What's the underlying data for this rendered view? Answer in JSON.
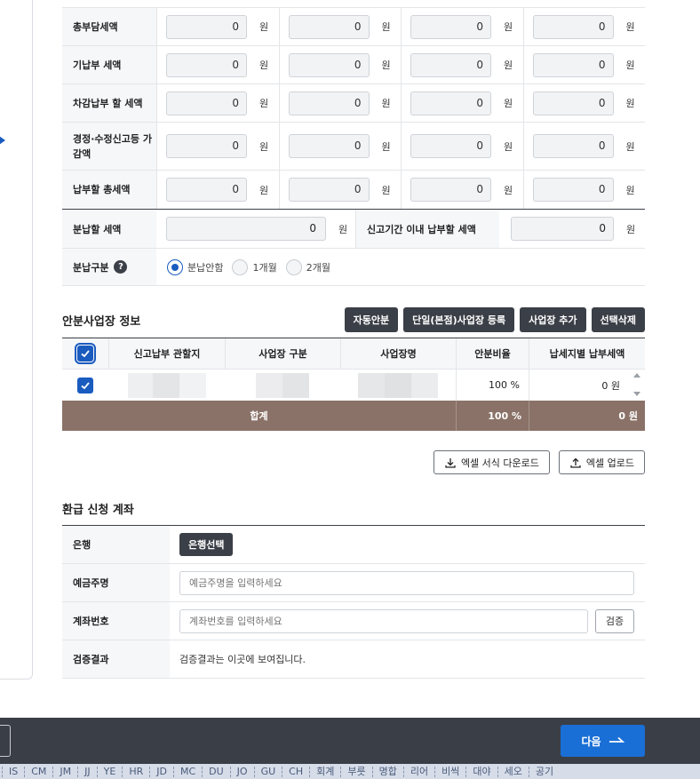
{
  "tax_grid": {
    "unit": "원",
    "rows": [
      {
        "label": "총부담세액",
        "values": [
          "0",
          "0",
          "0",
          "0"
        ]
      },
      {
        "label": "기납부 세액",
        "values": [
          "0",
          "0",
          "0",
          "0"
        ]
      },
      {
        "label": "차감납부 할 세액",
        "values": [
          "0",
          "0",
          "0",
          "0"
        ]
      },
      {
        "label": "경정·수정신고등 가감액",
        "values": [
          "0",
          "0",
          "0",
          "0"
        ]
      },
      {
        "label": "납부할 총세액",
        "values": [
          "0",
          "0",
          "0",
          "0"
        ]
      }
    ]
  },
  "split": {
    "label": "분납할 세액",
    "value": "0",
    "unit": "원",
    "deadline_label": "신고기간 이내 납부할 세액",
    "deadline_value": "0",
    "deadline_unit": "원"
  },
  "split_type": {
    "label": "분납구분",
    "help": "?",
    "options": [
      "분납안함",
      "1개월",
      "2개월"
    ],
    "selected": "분납안함"
  },
  "biz_section": {
    "title": "안분사업장 정보",
    "buttons": [
      "자동안분",
      "단일(본점)사업장 등록",
      "사업장 추가",
      "선택삭제"
    ],
    "columns": [
      "신고납부 관할지",
      "사업장 구분",
      "사업장명",
      "안분비율",
      "납세지별 납부세액"
    ],
    "rows": [
      {
        "ratio": "100 %",
        "amount": "0 원",
        "checked": true
      }
    ],
    "sum": {
      "label": "합계",
      "ratio": "100 %",
      "amount": "0 원"
    }
  },
  "excel": {
    "download_label": "엑셀 서식 다운로드",
    "upload_label": "엑셀 업로드"
  },
  "refund": {
    "title": "환급 신청 계좌",
    "bank_label": "은행",
    "bank_button": "은행선택",
    "holder_label": "예금주명",
    "holder_placeholder": "예금주명을 입력하세요",
    "account_label": "계좌번호",
    "account_placeholder": "계좌번호를 입력하세요",
    "verify_button": "검증",
    "result_label": "검증결과",
    "result_text": "검증결과는 이곳에 보여집니다."
  },
  "footer": {
    "next_label": "다음"
  },
  "taskbar": {
    "items": [
      "IS",
      "CM",
      "JM",
      "JJ",
      "YE",
      "HR",
      "JD",
      "MC",
      "DU",
      "JO",
      "GU",
      "CH",
      "회계",
      "부릇",
      "명합",
      "리어",
      "비씩",
      "대야",
      "세오",
      "공기"
    ]
  },
  "colors": {
    "accent": "#1a5bbf",
    "primary_button": "#1a6fd6",
    "dark_button": "#3b3f47",
    "sum_row": "#8a7268",
    "footer": "#3a3e47"
  }
}
